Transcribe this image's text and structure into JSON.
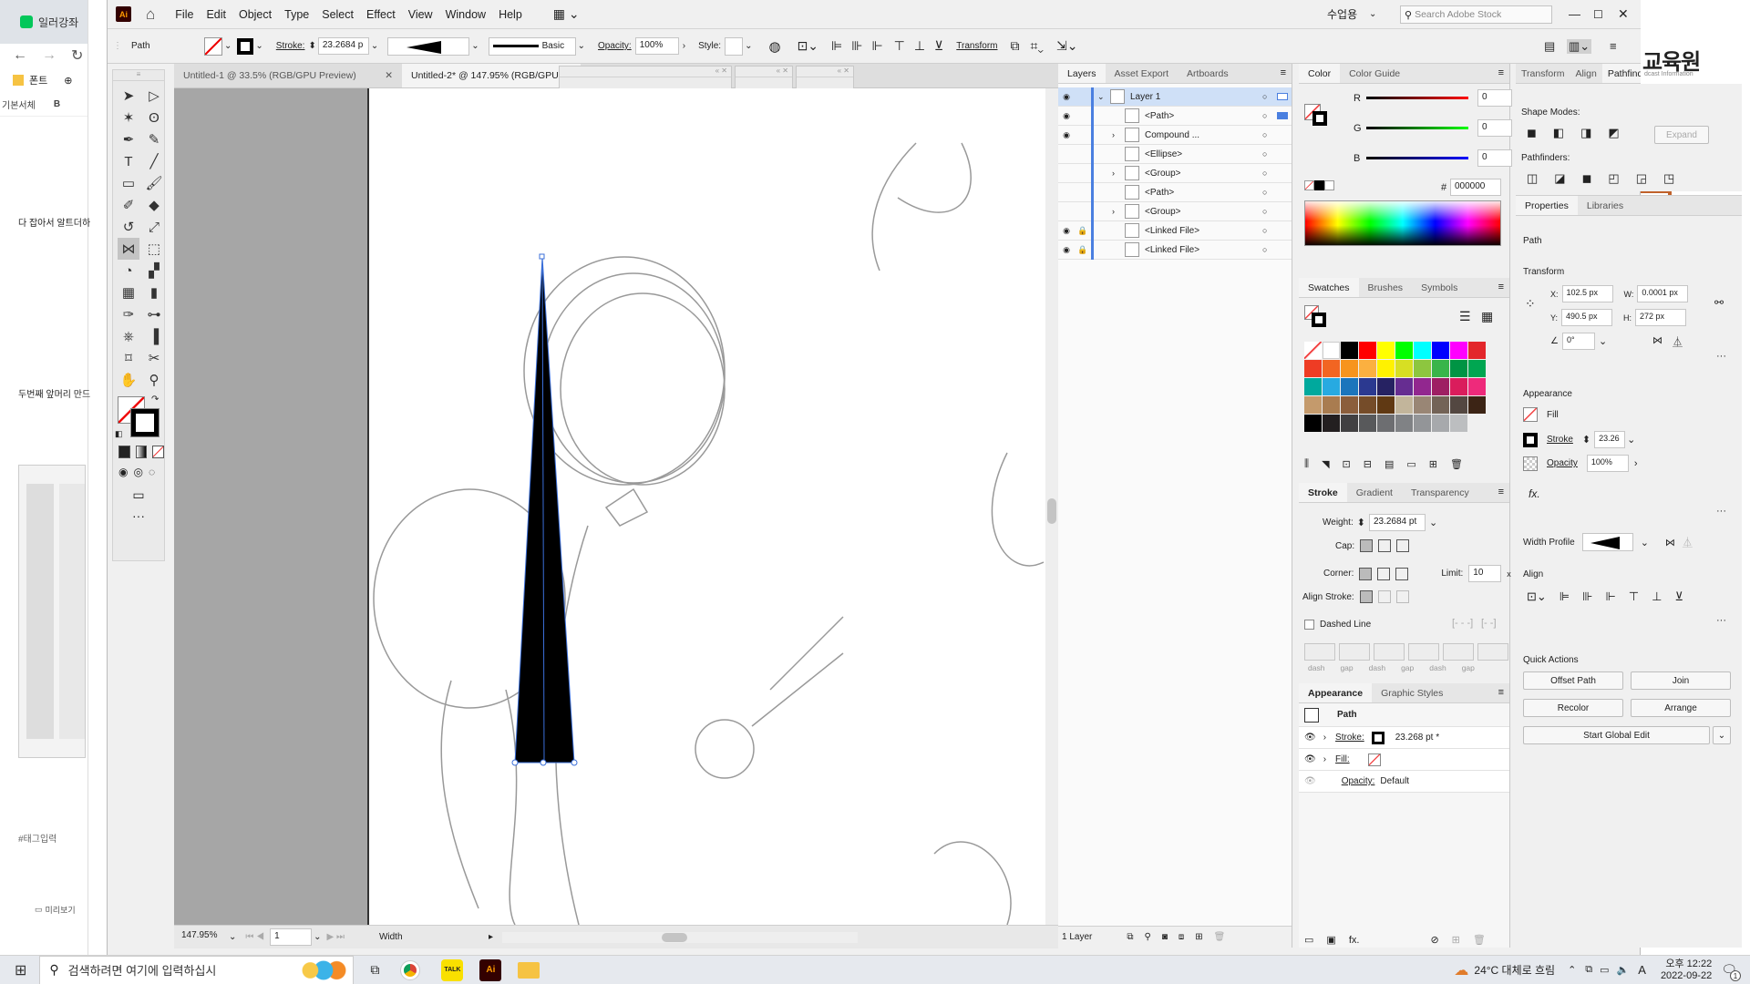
{
  "browser": {
    "tab_label": "일러강좌",
    "sidebar_fonts_label": "폰트",
    "sidebar_basic_label": "기본서체",
    "sidebar_bold_label": "B",
    "note1": "다 잡아서 알트더하",
    "note2": "두번째 앞머리 만드",
    "tag_input": "#태그입력",
    "preview_label": "미리보기",
    "right_brand": "교육원",
    "right_brand_sub": "dcast Information"
  },
  "menu": {
    "app_badge": "Ai",
    "items": [
      "File",
      "Edit",
      "Object",
      "Type",
      "Select",
      "Effect",
      "View",
      "Window",
      "Help"
    ],
    "workspace": "수업용",
    "search_placeholder": "Search Adobe Stock"
  },
  "control": {
    "selection_label": "Path",
    "stroke_label": "Stroke:",
    "stroke_value": "23.2684 p",
    "brush_label": "Basic",
    "opacity_label": "Opacity:",
    "opacity_value": "100%",
    "style_label": "Style:",
    "transform_label": "Transform"
  },
  "doc_tabs": [
    {
      "label": "Untitled-1 @ 33.5% (RGB/GPU Preview)",
      "active": false
    },
    {
      "label": "Untitled-2* @ 147.95% (RGB/GPU",
      "active": true
    }
  ],
  "status": {
    "zoom": "147.95%",
    "artboard": "1",
    "tool_name": "Width"
  },
  "layers": {
    "tabs": [
      "Layers",
      "Asset Export",
      "Artboards"
    ],
    "rows": [
      {
        "name": "Layer 1",
        "indent": 0,
        "eye": true,
        "lock": false,
        "expand": true
      },
      {
        "name": "<Path>",
        "indent": 1,
        "eye": true,
        "lock": false,
        "expand": false
      },
      {
        "name": "Compound ...",
        "indent": 1,
        "eye": true,
        "lock": false,
        "expand": true
      },
      {
        "name": "<Ellipse>",
        "indent": 1,
        "eye": false,
        "lock": false,
        "expand": false
      },
      {
        "name": "<Group>",
        "indent": 1,
        "eye": false,
        "lock": false,
        "expand": true
      },
      {
        "name": "<Path>",
        "indent": 1,
        "eye": false,
        "lock": false,
        "expand": false
      },
      {
        "name": "<Group>",
        "indent": 1,
        "eye": false,
        "lock": false,
        "expand": true
      },
      {
        "name": "<Linked File>",
        "indent": 1,
        "eye": true,
        "lock": true,
        "expand": false
      },
      {
        "name": "<Linked File>",
        "indent": 1,
        "eye": true,
        "lock": true,
        "expand": false
      }
    ],
    "footer": "1 Layer"
  },
  "color": {
    "tabs": [
      "Color",
      "Color Guide"
    ],
    "r_label": "R",
    "g_label": "G",
    "b_label": "B",
    "r": "0",
    "g": "0",
    "b": "0",
    "hash": "#",
    "hex": "000000"
  },
  "swatches": {
    "tabs": [
      "Swatches",
      "Brushes",
      "Symbols"
    ],
    "colors": [
      "#000000",
      "#ff0000",
      "#ffff00",
      "#00ff00",
      "#00ffff",
      "#0000ff",
      "#ff00ff",
      "#e3262b",
      "#ee3c24",
      "#f26522",
      "#f7941d",
      "#fbb040",
      "#fff200",
      "#d7df23",
      "#8dc63f",
      "#39b54a",
      "#009444",
      "#00a651",
      "#00a99d",
      "#27aae1",
      "#1c75bc",
      "#2b3990",
      "#262262",
      "#662d91",
      "#92278f",
      "#9e1f63",
      "#da1c5c",
      "#ee2a7b",
      "#c49a6c",
      "#a97c50",
      "#8b5e3c",
      "#754c29",
      "#603913",
      "#c2b59b",
      "#998675",
      "#736357",
      "#534741",
      "#3c2415",
      "#000000",
      "#231f20",
      "#414042",
      "#58595b",
      "#6d6e71",
      "#808285",
      "#939598",
      "#a7a9ac",
      "#bcbec0"
    ]
  },
  "stroke": {
    "tabs": [
      "Stroke",
      "Gradient",
      "Transparency"
    ],
    "weight_label": "Weight:",
    "weight_value": "23.2684 pt",
    "cap_label": "Cap:",
    "corner_label": "Corner:",
    "limit_label": "Limit:",
    "limit_value": "10",
    "limit_unit": "x",
    "align_label": "Align Stroke:",
    "dashed_label": "Dashed Line",
    "dash_labels": [
      "dash",
      "gap",
      "dash",
      "gap",
      "dash",
      "gap"
    ]
  },
  "appearance": {
    "tabs": [
      "Appearance",
      "Graphic Styles"
    ],
    "title": "Path",
    "stroke_label": "Stroke:",
    "stroke_value": "23.268 pt *",
    "fill_label": "Fill:",
    "opacity_label": "Opacity:",
    "opacity_value": "Default"
  },
  "pathfinder": {
    "tabs": [
      "Transform",
      "Align",
      "Pathfinder"
    ],
    "shape_modes": "Shape Modes:",
    "expand": "Expand",
    "pathfinders": "Pathfinders:"
  },
  "properties": {
    "tabs": [
      "Properties",
      "Libraries"
    ],
    "type": "Path",
    "transform": "Transform",
    "x_label": "X:",
    "x": "102.5 px",
    "y_label": "Y:",
    "y": "490.5 px",
    "w_label": "W:",
    "w": "0.0001 px",
    "h_label": "H:",
    "h": "272 px",
    "angle": "0°",
    "appearance": "Appearance",
    "fill": "Fill",
    "stroke": "Stroke",
    "stroke_value": "23.26",
    "opacity": "Opacity",
    "opacity_value": "100%",
    "fx": "fx.",
    "width_profile": "Width Profile",
    "align": "Align",
    "quick_actions": "Quick Actions",
    "offset_path": "Offset Path",
    "join": "Join",
    "recolor": "Recolor",
    "arrange": "Arrange",
    "global_edit": "Start Global Edit"
  },
  "taskbar": {
    "search_placeholder": "검색하려면 여기에 입력하십시",
    "weather": "24°C 대체로 흐림",
    "ime": "A",
    "time": "오후 12:22",
    "date": "2022-09-22",
    "notify_count": "1"
  }
}
